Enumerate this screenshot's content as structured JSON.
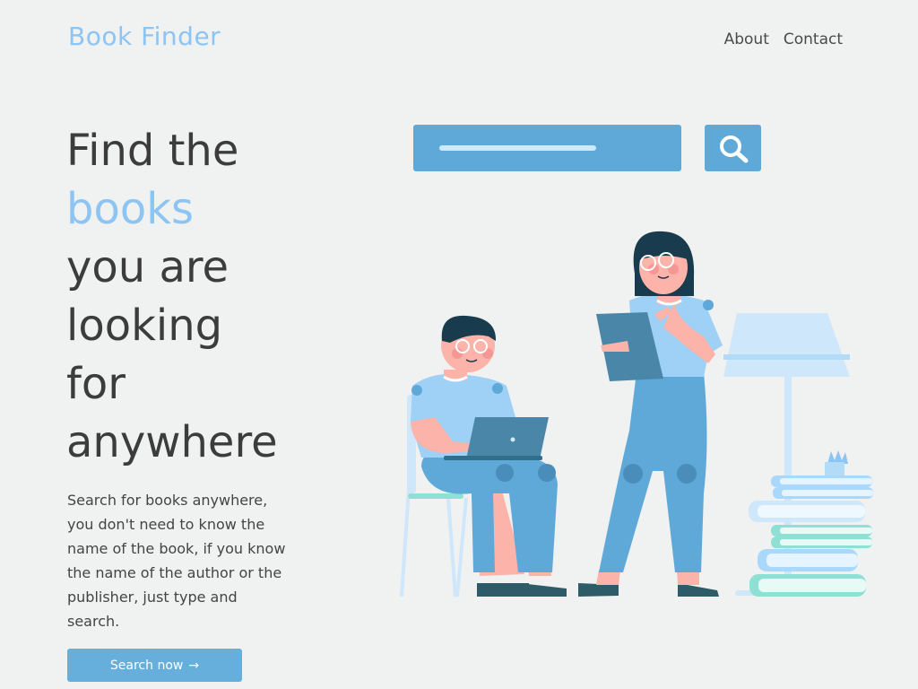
{
  "header": {
    "logo": "Book Finder",
    "nav": [
      {
        "label": "About"
      },
      {
        "label": "Contact"
      }
    ]
  },
  "hero": {
    "headline_lines": [
      "Find the",
      "books",
      "you are",
      "looking",
      "for",
      "anywhere"
    ],
    "highlighted_line_index": 1,
    "description": "Search for books anywhere, you don't need to know the name of the book, if you know the name of the author or the publisher, just type and search.",
    "cta_label": "Search now",
    "cta_icon": "arrow-right-icon"
  },
  "illustration": {
    "search_icon": "magnifier-icon"
  },
  "colors": {
    "background": "#f0f1f1",
    "accent": "#8cc4f3",
    "button": "#66aedc",
    "text": "#3c3c3c"
  }
}
